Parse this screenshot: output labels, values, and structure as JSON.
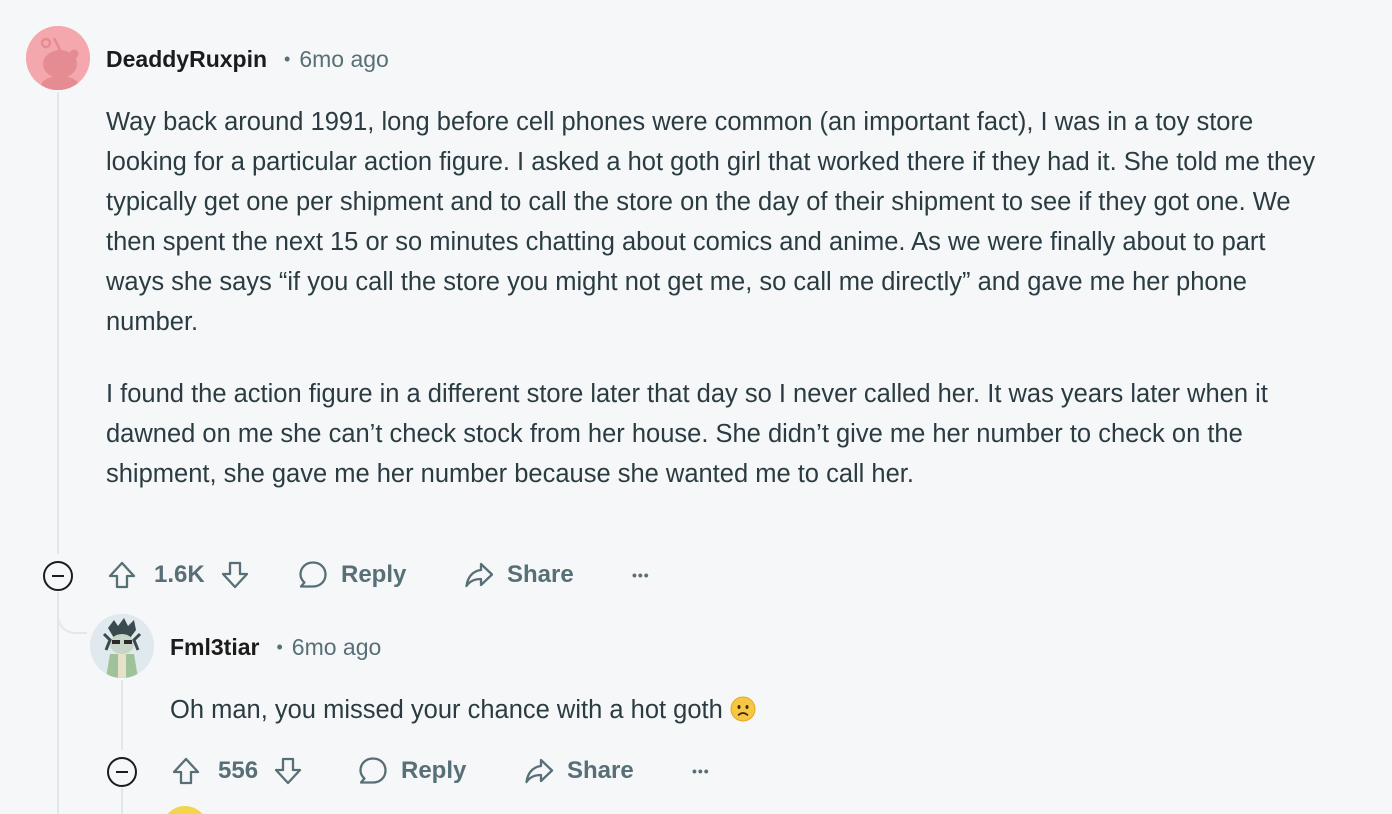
{
  "comment1": {
    "username": "DeaddyRuxpin",
    "time": "6mo ago",
    "paragraphs": [
      "Way back around 1991, long before cell phones were common (an important fact), I was in a toy store looking for a particular action figure. I asked a hot goth girl that worked there if they had it. She told me they typically get one per shipment and to call the store on the day of their shipment to see if they got one. We then spent the next 15 or so minutes chatting about comics and anime. As we were finally about to part ways she says “if you call the store you might not get me, so call me directly” and gave me her phone number.",
      "I found the action figure in a different store later that day so I never called her. It was years later when it dawned on me she can’t check stock from her house. She didn’t give me her number to check on the shipment, she gave me her number because she wanted me to call her."
    ],
    "votes": "1.6K",
    "reply_label": "Reply",
    "share_label": "Share",
    "more_label": "•••"
  },
  "comment2": {
    "username": "Fml3tiar",
    "time": "6mo ago",
    "text": "Oh man, you missed your chance with a hot goth",
    "emoji": "slightly-frowning-face",
    "votes": "556",
    "reply_label": "Reply",
    "share_label": "Share",
    "more_label": "•••"
  },
  "colors": {
    "background": "#f6f7f8",
    "text": "#2a3c42",
    "meta": "#576f76",
    "avatar1": "#f4a7ac"
  },
  "separator": "•"
}
